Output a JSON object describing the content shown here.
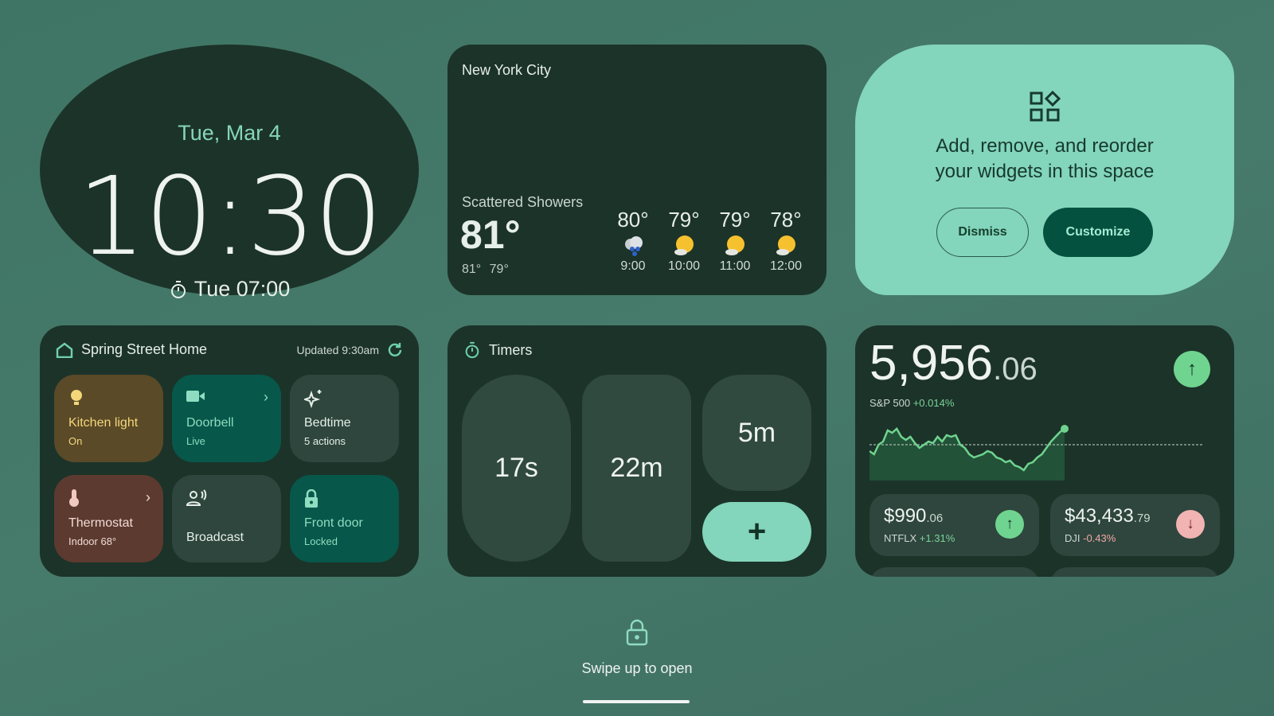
{
  "clock": {
    "date": "Tue, Mar 4",
    "time": "10:30",
    "alarm": "Tue 07:00",
    "accent": "#86d6ba"
  },
  "weather": {
    "city": "New York City",
    "condition": "Scattered Showers",
    "temp": "81°",
    "high": "81°",
    "low": "79°",
    "hourly": [
      {
        "temp": "80°",
        "time": "9:00",
        "icon": "rain-cloud-icon"
      },
      {
        "temp": "79°",
        "time": "10:00",
        "icon": "partly-sunny-icon"
      },
      {
        "temp": "79°",
        "time": "11:00",
        "icon": "partly-sunny-icon"
      },
      {
        "temp": "78°",
        "time": "12:00",
        "icon": "partly-sunny-icon"
      }
    ]
  },
  "promo": {
    "text_line1": "Add, remove, and reorder",
    "text_line2": "your widgets in this space",
    "dismiss": "Dismiss",
    "customize": "Customize",
    "bg": "#83d5bb"
  },
  "home": {
    "title": "Spring Street Home",
    "updated": "Updated 9:30am",
    "tiles": [
      {
        "name": "Kitchen light",
        "sub": "On",
        "icon": "lightbulb-icon",
        "color": "#5a4a28"
      },
      {
        "name": "Doorbell",
        "sub": "Live",
        "icon": "video-camera-icon",
        "color": "#07574a"
      },
      {
        "name": "Bedtime",
        "sub": "5 actions",
        "icon": "sparkle-icon",
        "color": "#2e463d"
      },
      {
        "name": "Thermostat",
        "sub": "Indoor 68°",
        "icon": "thermometer-icon",
        "color": "#5c3a30"
      },
      {
        "name": "Broadcast",
        "sub": "",
        "icon": "broadcast-icon",
        "color": "#2e463d"
      },
      {
        "name": "Front door",
        "sub": "Locked",
        "icon": "lock-icon",
        "color": "#07574a"
      }
    ]
  },
  "timers": {
    "title": "Timers",
    "items": [
      "17s",
      "22m",
      "5m"
    ],
    "add": "+"
  },
  "stocks": {
    "main": {
      "int": "5,956",
      "dec": ".06",
      "name": "S&P 500",
      "change": "+0.014%",
      "direction": "up"
    },
    "sparkline": [
      48,
      52,
      40,
      36,
      22,
      25,
      20,
      30,
      34,
      30,
      38,
      44,
      40,
      36,
      38,
      30,
      36,
      28,
      30,
      28,
      40,
      44,
      52,
      56,
      54,
      52,
      48,
      50,
      56,
      58,
      62,
      60,
      66,
      68,
      72,
      64,
      62,
      56,
      52,
      44,
      36,
      30,
      24,
      20
    ],
    "others": [
      {
        "int": "$990",
        "dec": ".06",
        "name": "NTFLX",
        "change": "+1.31%",
        "direction": "up"
      },
      {
        "int": "$43,433",
        "dec": ".79",
        "name": "DJI",
        "change": "-0.43%",
        "direction": "down"
      }
    ]
  },
  "lockscreen": {
    "hint": "Swipe up to open"
  }
}
